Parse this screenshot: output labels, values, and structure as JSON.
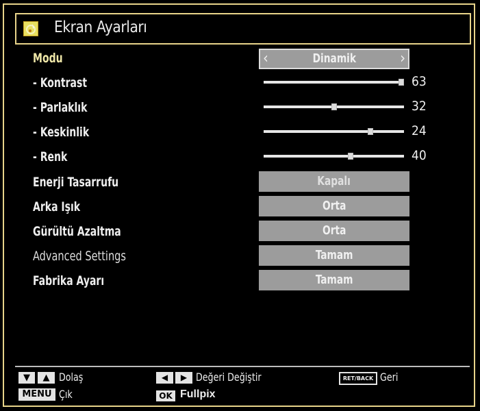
{
  "window": {
    "title": "Ekran Ayarları",
    "title_icon": "picture-settings-icon",
    "frame_color": "#e8d48a"
  },
  "menu": {
    "mode": {
      "label": "Modu",
      "value": "Dinamik",
      "prev_icon": "chevron-left-icon",
      "next_icon": "chevron-right-icon"
    },
    "sliders": [
      {
        "label": "- Kontrast",
        "value": "63",
        "fraction": 0.98
      },
      {
        "label": "- Parlaklık",
        "value": "32",
        "fraction": 0.5
      },
      {
        "label": "- Keskinlik",
        "value": "24",
        "fraction": 0.76
      },
      {
        "label": "- Renk",
        "value": "40",
        "fraction": 0.62
      }
    ],
    "options": [
      {
        "label": "Enerji Tasarrufu",
        "value": "Kapalı"
      },
      {
        "label": "Arka Işık",
        "value": "Orta"
      },
      {
        "label": "Gürültü Azaltma",
        "value": "Orta"
      },
      {
        "label": "Advanced Settings",
        "value": "Tamam"
      },
      {
        "label": "Fabrika Ayarı",
        "value": "Tamam"
      }
    ]
  },
  "footer": {
    "navigate": {
      "keys": [
        "▼",
        "▲"
      ],
      "label": "Dolaş"
    },
    "change": {
      "keys": [
        "◀",
        "▶"
      ],
      "label": "Değeri Değiştir"
    },
    "back": {
      "key": "RET/BACK",
      "label": "Geri"
    },
    "menu": {
      "key": "MENU",
      "label": "Çık"
    },
    "ok": {
      "key": "OK",
      "label": "Fullpix"
    }
  }
}
